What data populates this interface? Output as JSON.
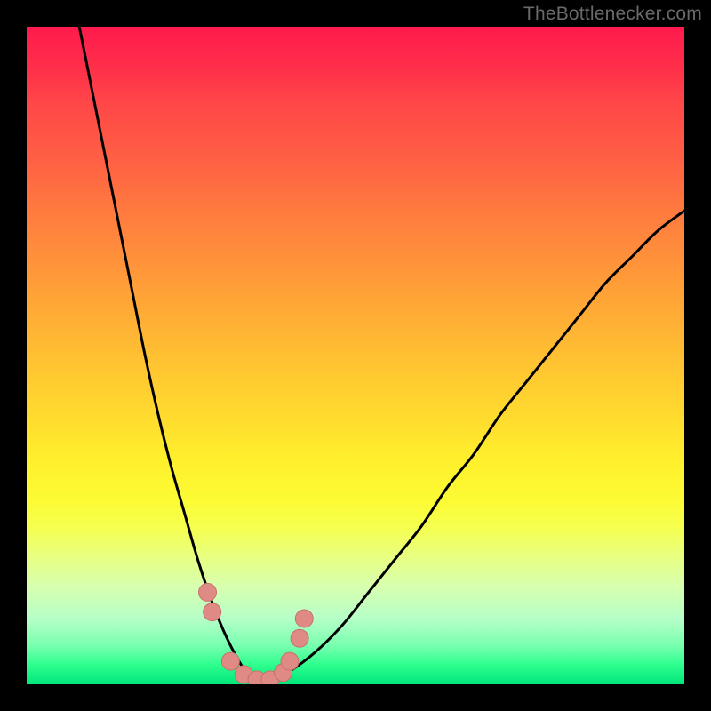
{
  "watermark": {
    "text": "TheBottlenecker.com"
  },
  "colors": {
    "frame": "#000000",
    "gradient_top": "#ff1a4d",
    "gradient_mid": "#ffdd2e",
    "gradient_bottom": "#00e57a",
    "curve_stroke": "#000000",
    "marker_fill": "#e08a86",
    "marker_stroke": "#c96f6a"
  },
  "chart_data": {
    "type": "line",
    "title": "",
    "xlabel": "",
    "ylabel": "",
    "x_range": [
      0,
      100
    ],
    "y_range": [
      0,
      100
    ],
    "description": "V-shaped bottleneck curve; minimum sits near x≈35, y≈0. Left branch rises steeply to y=100 at x≈8; right branch rises more gently to y≈72 at x=100. Background gradient encodes severity (red=bad at top, green=good at bottom).",
    "series": [
      {
        "name": "left_branch",
        "x": [
          8,
          10,
          12,
          14,
          16,
          18,
          20,
          22,
          24,
          26,
          28,
          30,
          32,
          34,
          36
        ],
        "y": [
          100,
          90,
          80,
          70,
          60,
          50,
          41,
          33,
          26,
          19,
          13,
          8,
          4,
          1,
          0
        ]
      },
      {
        "name": "right_branch",
        "x": [
          36,
          40,
          44,
          48,
          52,
          56,
          60,
          64,
          68,
          72,
          76,
          80,
          84,
          88,
          92,
          96,
          100
        ],
        "y": [
          0,
          2,
          5,
          9,
          14,
          19,
          24,
          30,
          35,
          41,
          46,
          51,
          56,
          61,
          65,
          69,
          72
        ]
      }
    ],
    "markers": {
      "name": "highlighted_points_near_minimum",
      "x": [
        27.5,
        28.2,
        31.0,
        33.0,
        35.0,
        37.0,
        39.0,
        40.0,
        41.5,
        42.2
      ],
      "y": [
        14.0,
        11.0,
        3.5,
        1.5,
        0.7,
        0.7,
        1.8,
        3.5,
        7.0,
        10.0
      ]
    }
  }
}
